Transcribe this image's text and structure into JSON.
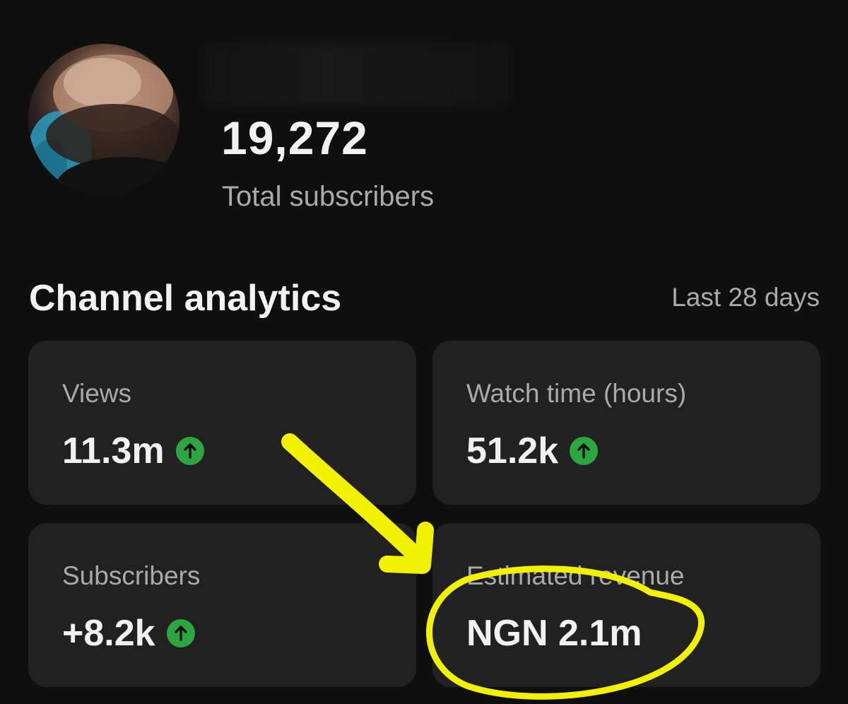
{
  "header": {
    "subscriber_count": "19,272",
    "subscriber_label": "Total subscribers"
  },
  "analytics": {
    "title": "Channel analytics",
    "period": "Last 28 days",
    "cards": [
      {
        "label": "Views",
        "value": "11.3m",
        "trend": "up"
      },
      {
        "label": "Watch time (hours)",
        "value": "51.2k",
        "trend": "up"
      },
      {
        "label": "Subscribers",
        "value": "+8.2k",
        "trend": "up"
      },
      {
        "label": "Estimated revenue",
        "value": "NGN 2.1m"
      }
    ]
  },
  "colors": {
    "background": "#0f0f0f",
    "card": "#212121",
    "trend_up": "#2ba640",
    "annotation": "#f2f200"
  },
  "icons": {
    "trend": "arrow-up-icon"
  }
}
